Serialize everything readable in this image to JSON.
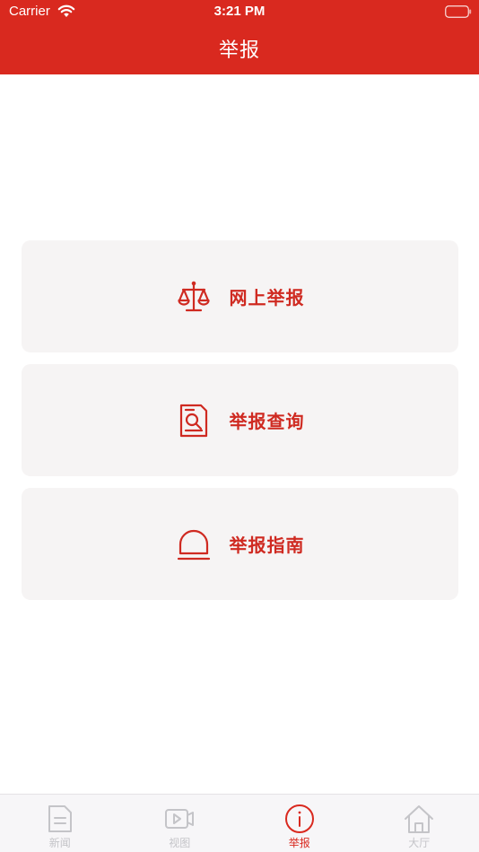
{
  "status_bar": {
    "carrier": "Carrier",
    "time": "3:21 PM"
  },
  "nav": {
    "title": "举报"
  },
  "actions": [
    {
      "label": "网上举报",
      "icon": "scales-icon"
    },
    {
      "label": "举报查询",
      "icon": "document-search-icon"
    },
    {
      "label": "举报指南",
      "icon": "alarm-bell-icon"
    }
  ],
  "tabs": [
    {
      "label": "新闻",
      "icon": "news-icon",
      "active": false
    },
    {
      "label": "视图",
      "icon": "video-icon",
      "active": false
    },
    {
      "label": "举报",
      "icon": "info-icon",
      "active": true
    },
    {
      "label": "大厅",
      "icon": "home-icon",
      "active": false
    }
  ],
  "colors": {
    "brand_red": "#d9291f",
    "card_bg": "#f6f4f4",
    "tab_inactive": "#c4c4c8"
  }
}
